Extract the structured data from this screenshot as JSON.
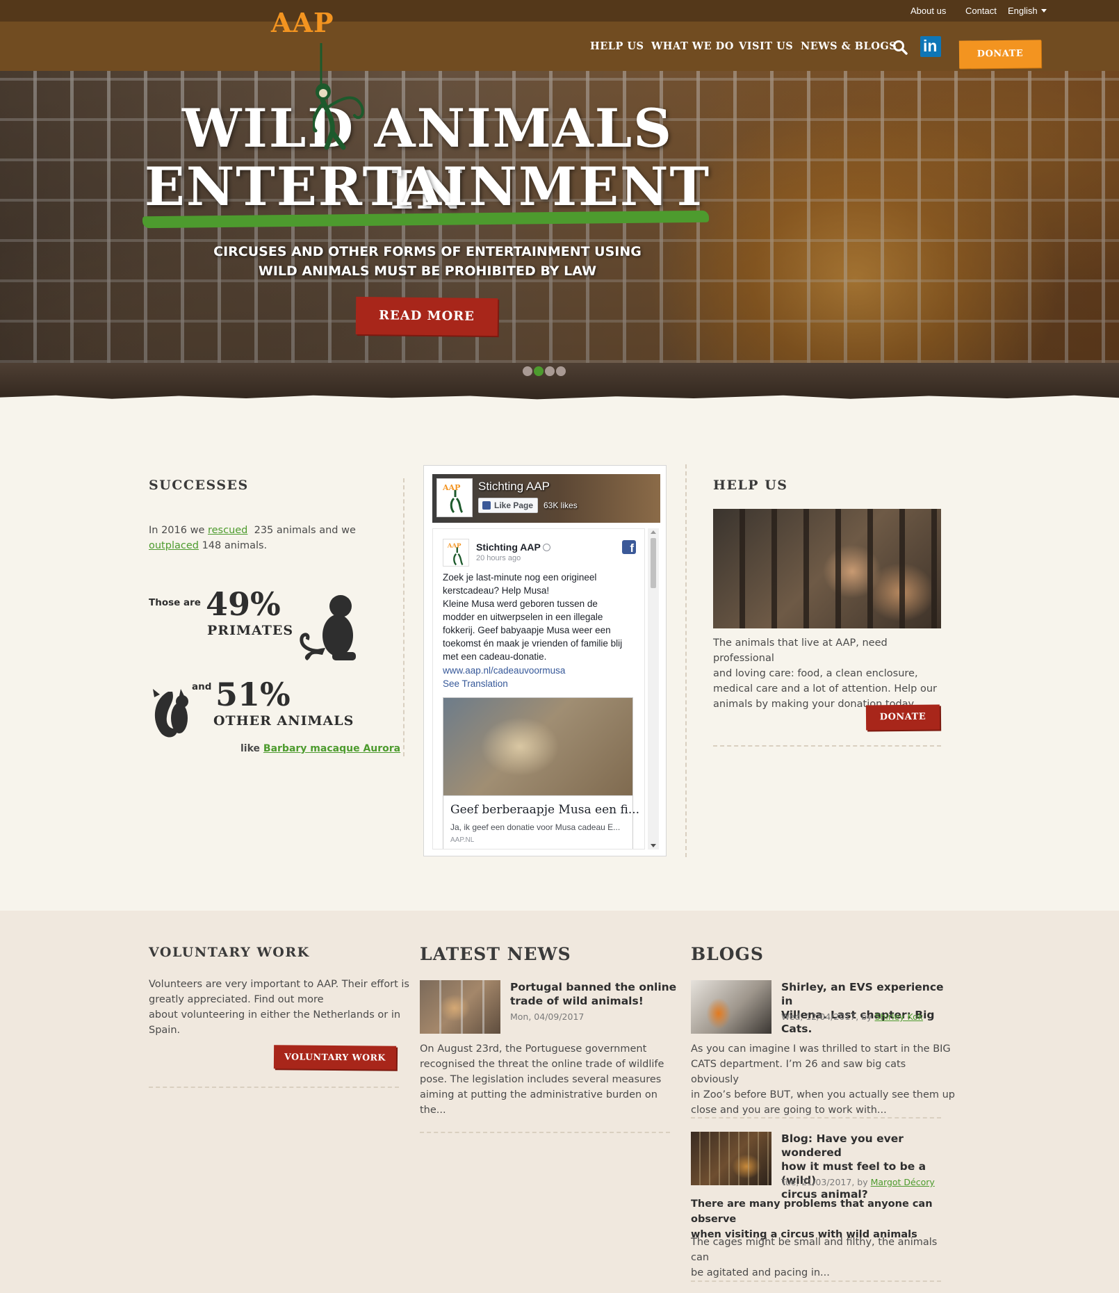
{
  "topbar": {
    "about": "About us",
    "contact": "Contact",
    "language": "English"
  },
  "nav": {
    "logo": "AAP",
    "items": [
      "HELP US",
      "WHAT WE DO",
      "VISIT US",
      "NEWS & BLOGS"
    ],
    "linkedin": "in",
    "donate": "DONATE"
  },
  "hero": {
    "title_line1": "WILD ANIMALS IN",
    "title_line2": "ENTERTAINMENT",
    "subtitle": "CIRCUSES AND OTHER FORMS OF ENTERTAINMENT USING WILD ANIMALS MUST BE PROHIBITED BY LAW",
    "button": "READ MORE",
    "slides": 4,
    "active_slide": 2
  },
  "successes": {
    "heading": "SUCCESSES",
    "text_pre": "In 2016 we",
    "rescued_link": "rescued",
    "text_mid": "235 animals and we",
    "outplaced_link": "outplaced",
    "text_post": "148 animals.",
    "those_are": "Those are",
    "primates_pct": "49%",
    "primates_label": "PRIMATES",
    "and": "and",
    "other_pct": "51%",
    "other_label": "OTHER ANIMALS",
    "like": "like",
    "example_link": "Barbary macaque Aurora"
  },
  "facebook": {
    "page_name": "Stichting AAP",
    "like_button": "Like Page",
    "likes": "63K likes",
    "post_author": "Stichting AAP",
    "post_time": "20 hours ago",
    "post_lines": [
      "Zoek je last-minute nog een origineel",
      "kerstcadeau? Help Musa!",
      "Kleine Musa werd geboren tussen de",
      "modder en uitwerpselen in een illegale",
      "fokkerij. Geef babyaapje Musa weer een",
      "toekomst én maak je vrienden of familie blij",
      "met een cadeau-donatie."
    ],
    "post_link": "www.aap.nl/cadeauvoormusa",
    "see_translation": "See Translation",
    "card_title": "Geef berberaapje Musa een fi...",
    "card_desc": "Ja, ik geef een donatie voor Musa cadeau E...",
    "card_source": "AAP.NL"
  },
  "helpus": {
    "heading": "HELP US",
    "lines": [
      "The animals that live at AAP, need professional",
      "and loving care: food, a clean enclosure,",
      "medical care and a lot of attention. Help our",
      "animals by making your donation today."
    ],
    "button": "DONATE"
  },
  "voluntary": {
    "heading": "VOLUNTARY WORK",
    "lines": [
      "Volunteers are very important to AAP. Their effort is",
      "greatly appreciated. Find out more",
      "about volunteering in either the Netherlands or in",
      "Spain."
    ],
    "button": "VOLUNTARY WORK"
  },
  "news": {
    "heading": "LATEST NEWS",
    "title_lines": [
      "Portugal banned the online",
      "trade of wild animals!"
    ],
    "date": "Mon, 04/09/2017",
    "lines": [
      "On August 23rd, the Portuguese government",
      "recognised the threat the online trade of wildlife",
      "pose. The legislation includes several measures",
      "aiming at putting the administrative burden on",
      "the..."
    ]
  },
  "blogs": {
    "heading": "BLOGS",
    "items": [
      {
        "title_lines": [
          "Shirley, an EVS experience in",
          "Villena. Last chapter: Big Cats."
        ],
        "date": "Wed, 12/04/2017, by",
        "author": "Shirley Kok",
        "lines": [
          "As you can imagine I was thrilled to start in the BIG",
          "CATS department. I’m 26 and saw big cats obviously",
          "in Zoo’s before BUT, when you actually see them up",
          "close and you are going to work with..."
        ]
      },
      {
        "title_lines": [
          "Blog: Have you ever wondered",
          "how it must feel to be a (wild)",
          "circus animal?"
        ],
        "date": "Tue, 21/03/2017, by",
        "author": "Margot Décory",
        "lead_lines": [
          "There are many problems that anyone can observe",
          "when visiting a circus with wild animals"
        ],
        "lines": [
          "The cages might be small and filthy, the animals can",
          "be agitated and pacing in..."
        ]
      }
    ]
  },
  "colors": {
    "topbar": "#54381a",
    "navbar": "#714c21",
    "orange": "#f39420",
    "red": "#a8261a",
    "green": "#4d9b2e",
    "page_bg": "#f7f4ec",
    "bottom_bg": "#f0e8de"
  }
}
